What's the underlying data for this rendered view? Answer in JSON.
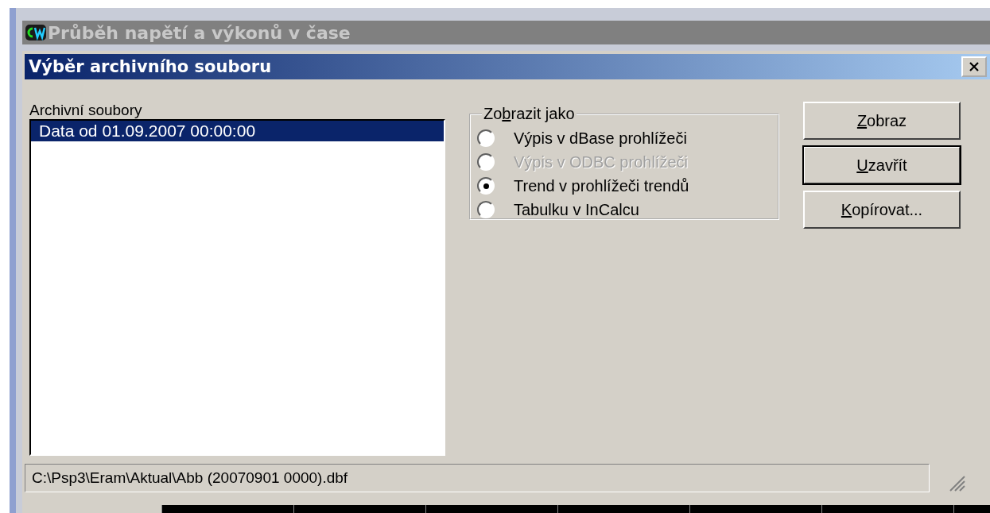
{
  "main_window": {
    "title": "Průběh napětí a výkonů v čase"
  },
  "dialog": {
    "title": "Výběr archivního souboru"
  },
  "file_list": {
    "label": "Archivní soubory",
    "items": [
      {
        "text": "Data od 01.09.2007 00:00:00",
        "selected": true
      }
    ]
  },
  "display_group": {
    "label": {
      "before": "Zo",
      "key": "b",
      "after": "razit jako"
    },
    "options": [
      {
        "label": "Výpis v dBase prohlížeči",
        "selected": false,
        "disabled": false
      },
      {
        "label": "Výpis v ODBC prohlížeči",
        "selected": false,
        "disabled": true
      },
      {
        "label": "Trend v prohlížeči trendů",
        "selected": true,
        "disabled": false
      },
      {
        "label": "Tabulku v InCalcu",
        "selected": false,
        "disabled": false
      }
    ]
  },
  "buttons": [
    {
      "key": "Z",
      "after": "obraz",
      "default": false
    },
    {
      "key": "U",
      "after": "zavřít",
      "default": true
    },
    {
      "key": "K",
      "after": "opírovat...",
      "default": false
    }
  ],
  "status_bar": {
    "path": "C:\\Psp3\\Eram\\Aktual\\Abb (20070901 0000).dbf"
  }
}
